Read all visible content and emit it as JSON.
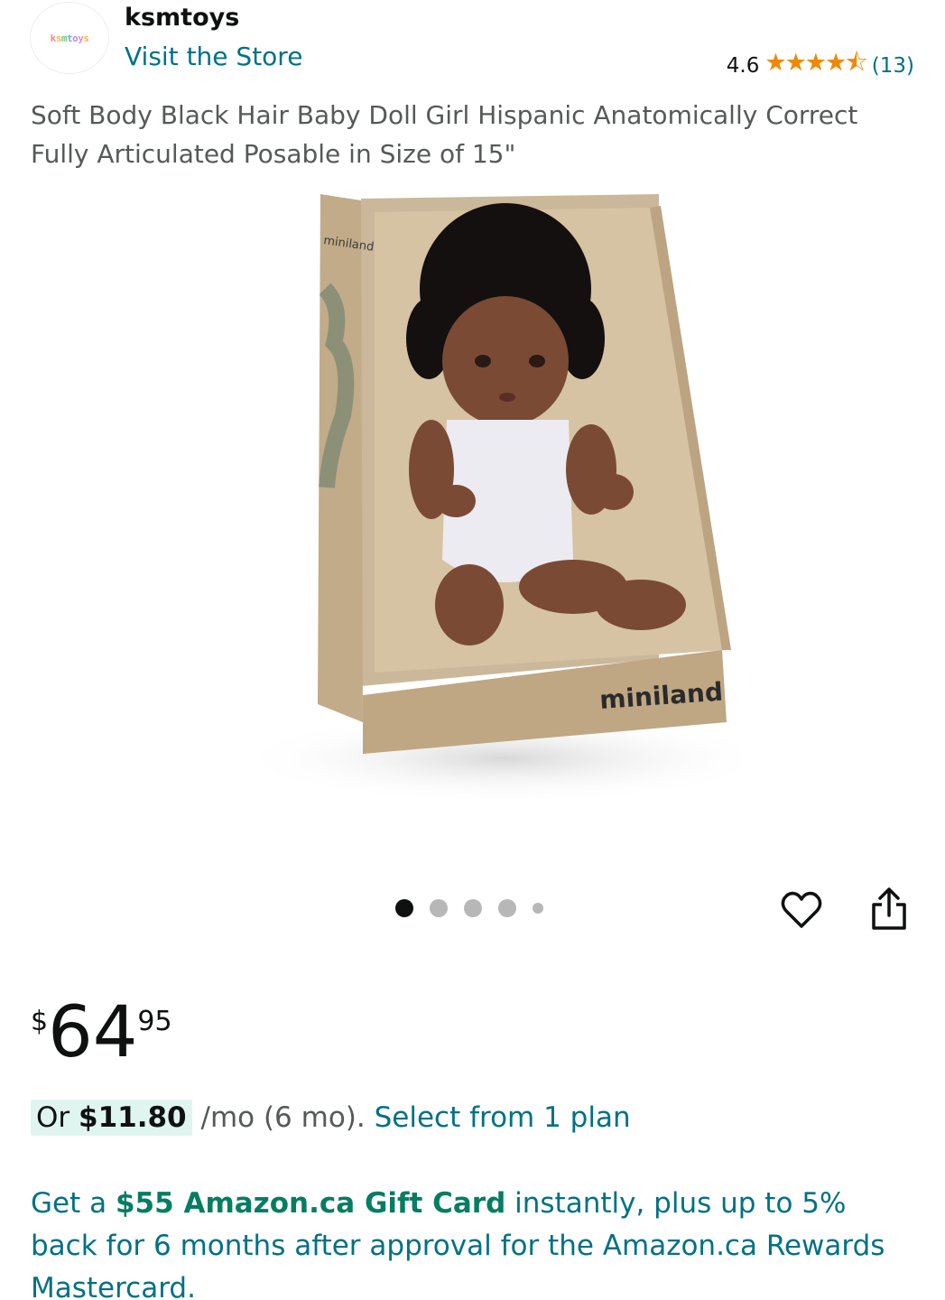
{
  "store": {
    "logo_text": "ksmtoys",
    "name": "ksmtoys",
    "visit_label": "Visit the Store"
  },
  "rating": {
    "value": "4.6",
    "stars": 4.6,
    "count": "(13)"
  },
  "product": {
    "title": "Soft Body Black Hair Baby Doll Girl Hispanic Anatomically Correct Fully Articulated Posable in Size of 15\"",
    "image_brand_text": "miniland",
    "image_box_side_text": "miniland"
  },
  "carousel": {
    "total": 5,
    "active_index": 0
  },
  "actions": {
    "wishlist_icon": "heart-outline-icon",
    "share_icon": "share-icon"
  },
  "price": {
    "symbol": "$",
    "whole": "64",
    "fraction": "95"
  },
  "installment": {
    "prefix": "Or ",
    "amount": "$11.80",
    "suffix": " /mo (6 mo). ",
    "link": "Select from 1 plan"
  },
  "promo": {
    "part1": "Get a ",
    "highlight": "$55 Amazon.ca Gift Card",
    "part2": " instantly, plus up to 5% back for 6 months after approval for the Amazon.ca Rewards Mastercard."
  },
  "colors": {
    "link": "#007185",
    "star": "#f08804",
    "promo_green": "#067d62",
    "pill_bg": "#e0f5ef"
  }
}
